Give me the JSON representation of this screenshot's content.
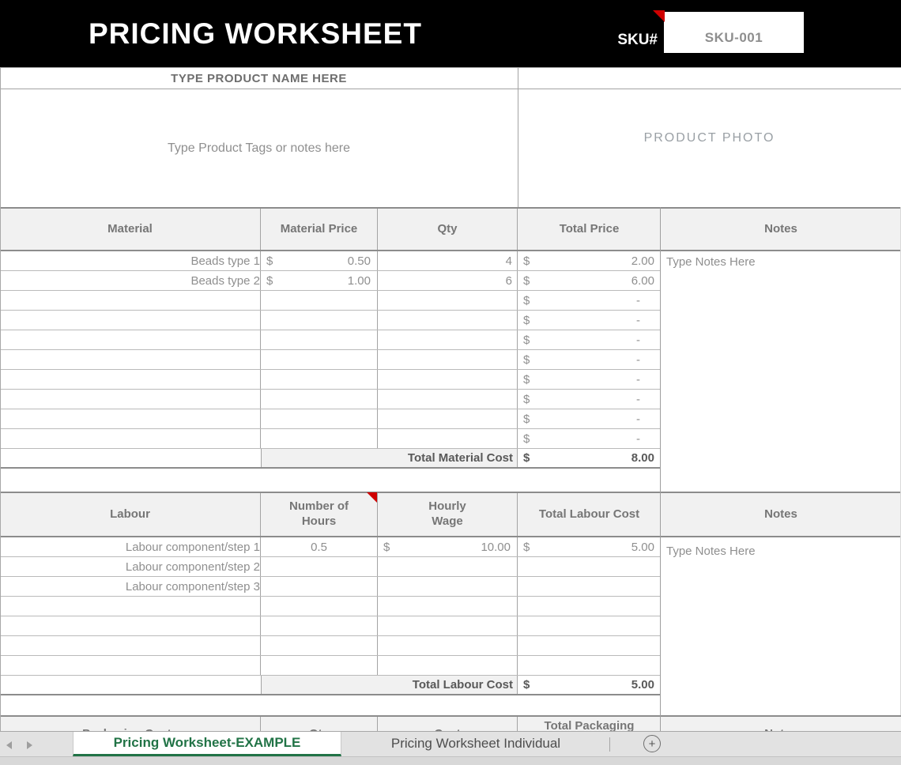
{
  "header": {
    "title": "PRICING WORKSHEET",
    "sku_label": "SKU#",
    "sku_value": "SKU-001"
  },
  "product": {
    "name_placeholder": "TYPE PRODUCT NAME HERE",
    "tags_placeholder": "Type Product Tags or notes here",
    "photo_placeholder": "PRODUCT PHOTO"
  },
  "material": {
    "headers": {
      "col1": "Material",
      "col2": "Material Price",
      "col3": "Qty",
      "col4": "Total Price",
      "col5": "Notes"
    },
    "rows": [
      {
        "name": "Beads type 1",
        "cur": "$",
        "price": "0.50",
        "qty": "4",
        "tcur": "$",
        "total": "2.00"
      },
      {
        "name": "Beads type 2",
        "cur": "$",
        "price": "1.00",
        "qty": "6",
        "tcur": "$",
        "total": "6.00"
      },
      {
        "name": "",
        "cur": "",
        "price": "",
        "qty": "",
        "tcur": "$",
        "total": "-"
      },
      {
        "name": "",
        "cur": "",
        "price": "",
        "qty": "",
        "tcur": "$",
        "total": "-"
      },
      {
        "name": "",
        "cur": "",
        "price": "",
        "qty": "",
        "tcur": "$",
        "total": "-"
      },
      {
        "name": "",
        "cur": "",
        "price": "",
        "qty": "",
        "tcur": "$",
        "total": "-"
      },
      {
        "name": "",
        "cur": "",
        "price": "",
        "qty": "",
        "tcur": "$",
        "total": "-"
      },
      {
        "name": "",
        "cur": "",
        "price": "",
        "qty": "",
        "tcur": "$",
        "total": "-"
      },
      {
        "name": "",
        "cur": "",
        "price": "",
        "qty": "",
        "tcur": "$",
        "total": "-"
      },
      {
        "name": "",
        "cur": "",
        "price": "",
        "qty": "",
        "tcur": "$",
        "total": "-"
      }
    ],
    "notes_placeholder": "Type Notes Here",
    "total_label": "Total Material Cost",
    "total_cur": "$",
    "total_value": "8.00"
  },
  "labour": {
    "headers": {
      "col1": "Labour",
      "col2": "Number of\nHours",
      "col3": "Hourly\nWage",
      "col4": "Total Labour Cost",
      "col5": "Notes"
    },
    "rows": [
      {
        "name": "Labour component/step 1",
        "hours": "0.5",
        "wcur": "$",
        "wage": "10.00",
        "tcur": "$",
        "total": "5.00"
      },
      {
        "name": "Labour component/step 2",
        "hours": "",
        "wcur": "",
        "wage": "",
        "tcur": "",
        "total": ""
      },
      {
        "name": "Labour component/step 3",
        "hours": "",
        "wcur": "",
        "wage": "",
        "tcur": "",
        "total": ""
      },
      {
        "name": "",
        "hours": "",
        "wcur": "",
        "wage": "",
        "tcur": "",
        "total": ""
      },
      {
        "name": "",
        "hours": "",
        "wcur": "",
        "wage": "",
        "tcur": "",
        "total": ""
      },
      {
        "name": "",
        "hours": "",
        "wcur": "",
        "wage": "",
        "tcur": "",
        "total": ""
      },
      {
        "name": "",
        "hours": "",
        "wcur": "",
        "wage": "",
        "tcur": "",
        "total": ""
      }
    ],
    "notes_placeholder": "Type Notes Here",
    "total_label": "Total Labour Cost",
    "total_cur": "$",
    "total_value": "5.00"
  },
  "packaging": {
    "headers": {
      "col1": "Packaging Costs",
      "col2": "Qty",
      "col3": "Cost",
      "col4": "Total Packaging\nCost",
      "col5": "Notes"
    }
  },
  "tabs": {
    "active_label": "Pricing Worksheet-EXAMPLE",
    "inactive_label": "Pricing Worksheet Individual",
    "add_label": "+"
  },
  "colors": {
    "accent_green": "#217346",
    "comment_red": "#cf0000",
    "black_bar": "#000000",
    "grid_gray": "#8c8c8c"
  }
}
